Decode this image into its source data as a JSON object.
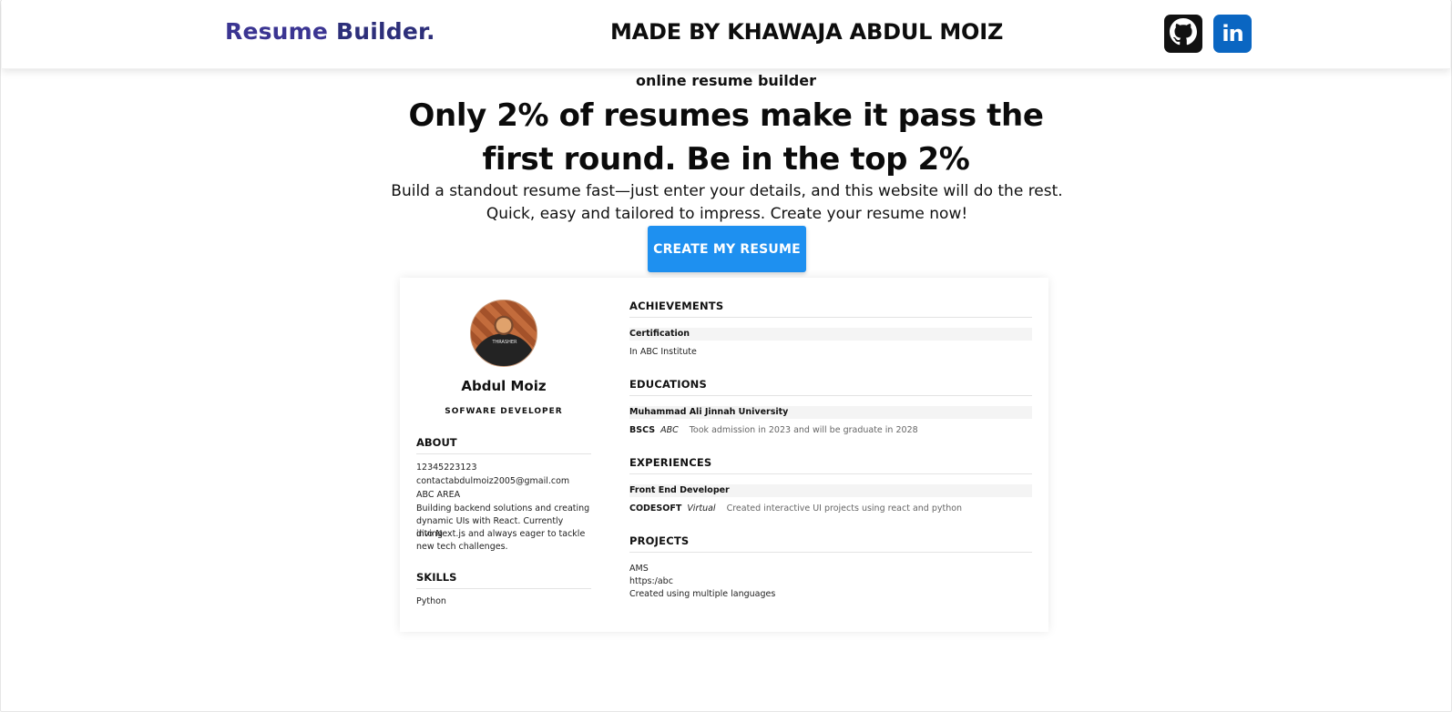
{
  "header": {
    "logo_word1": "Resume",
    "logo_word2": " Builder.",
    "made_by": "MADE BY KHAWAJA ABDUL MOIZ",
    "icons": [
      "github-icon",
      "linkedin-icon"
    ],
    "linkedin_text": "in"
  },
  "hero": {
    "eyebrow": "online resume builder",
    "headline": "Only 2% of resumes make it pass the first round. Be in the top 2%",
    "subtext": "Build a standout resume fast—just enter your details, and this website will do the rest. Quick, easy and tailored to impress. Create your resume now!",
    "cta_label": "CREATE MY RESUME"
  },
  "preview": {
    "name": "Abdul Moiz",
    "role": "SOFWARE DEVELOPER",
    "avatar_shirt_text": "THRASHER",
    "about": {
      "title": "ABOUT",
      "phone": "12345223123",
      "email": "contactabdulmoiz2005@gmail.com",
      "address": "ABC AREA",
      "bio": [
        "Building backend solutions and creating",
        "dynamic UIs with React. Currently diving",
        "into Next.js and always eager to tackle",
        "new tech challenges."
      ]
    },
    "skills": {
      "title": "SKILLS",
      "items": [
        "Python"
      ]
    },
    "achievements": {
      "title": "ACHIEVEMENTS",
      "item_title": "Certification",
      "item_detail": "In ABC Institute"
    },
    "educations": {
      "title": "EDUCATIONS",
      "school": "Muhammad Ali Jinnah University",
      "degree": "BSCS",
      "tag": "ABC",
      "detail": "Took admission in 2023 and will be graduate in 2028"
    },
    "experiences": {
      "title": "EXPERIENCES",
      "role": "Front End Developer",
      "company": "CODESOFT",
      "mode": "Virtual",
      "detail": "Created interactive UI projects using react and python"
    },
    "projects": {
      "title": "PROJECTS",
      "name": "AMS",
      "link": "https:/abc",
      "detail": "Created using multiple languages"
    }
  },
  "colors": {
    "logo_resume": "#3b3592",
    "logo_builder": "#2d2f7a",
    "cta": "#1e90f0",
    "github": "#111111",
    "linkedin": "#0a66c2"
  }
}
